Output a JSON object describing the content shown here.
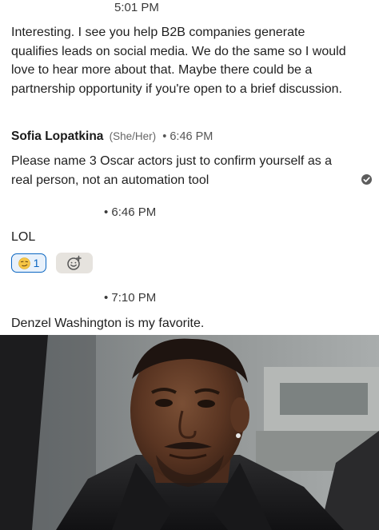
{
  "messages": {
    "first": {
      "time": "5:01 PM",
      "text": "Interesting. I see you help B2B companies generate qualifies leads on social media. We do the same so I would love to hear more about that. Maybe there could be a partnership opportunity if you're open to a brief discussion."
    },
    "sender": {
      "name": "Sofia Lopatkina",
      "pronouns": "(She/Her)",
      "time": "• 6:46 PM"
    },
    "second": {
      "text": "Please name 3 Oscar actors just to confirm yourself as a real person, not an automation tool"
    },
    "third": {
      "time": "• 6:46 PM",
      "text": "LOL",
      "reaction": {
        "icon": "smirk-emoji-icon",
        "count": "1"
      },
      "add_reaction_icon": "smiley-plus-icon"
    },
    "fourth": {
      "time": "• 7:10 PM",
      "text": "Denzel Washington is my favorite."
    }
  },
  "image": {
    "subject": "photo-of-man-in-car"
  },
  "colors": {
    "accent": "#0a66c2",
    "read_receipt": "#5c5c5c"
  }
}
